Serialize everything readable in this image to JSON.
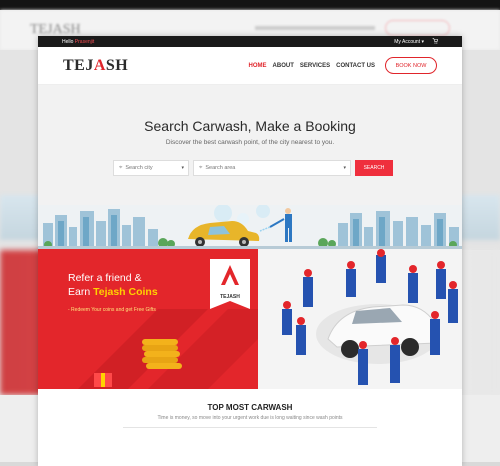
{
  "topbar": {
    "hello": "Hello",
    "user": "Prasenjit",
    "account_label": "My Account",
    "account_caret": "▾",
    "cart_icon": "cart-icon"
  },
  "brand": {
    "logo_pre": "TEJ",
    "logo_a": "A",
    "logo_post": "SH"
  },
  "nav": {
    "items": [
      "HOME",
      "ABOUT",
      "SERVICES",
      "CONTACT US"
    ],
    "book_label": "BOOK NOW"
  },
  "hero": {
    "title": "Search Carwash, Make a Booking",
    "subtitle": "Discover the best carwash point, of the city nearest to you.",
    "city_placeholder": "Search city",
    "area_placeholder": "Search area",
    "search_label": "SEARCH"
  },
  "promo": {
    "line1": "Refer a friend &",
    "line2_pre": "Earn ",
    "line2_coins": "Tejash Coins",
    "line3": "- Redeem Your coins and get Free Gifts",
    "badge_letter": "A",
    "badge_text": "TEJASH"
  },
  "section": {
    "title": "TOP MOST CARWASH",
    "subtitle": "Time is money, so move into your urgent work due is long waiting since wash points"
  },
  "colors": {
    "accent": "#e0252b",
    "topbar": "#1a1a1a"
  }
}
